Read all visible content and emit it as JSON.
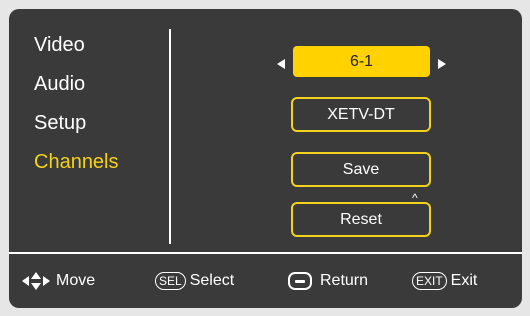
{
  "menu": {
    "items": [
      {
        "label": "Video"
      },
      {
        "label": "Audio"
      },
      {
        "label": "Setup"
      },
      {
        "label": "Channels"
      }
    ],
    "active_index": 3
  },
  "channel": {
    "number": "6-1",
    "name": "XETV-DT"
  },
  "buttons": {
    "save": "Save",
    "reset": "Reset"
  },
  "overlay_glyph": "^",
  "hints": {
    "move": {
      "label": "Move"
    },
    "select": {
      "key": "SEL",
      "label": "Select"
    },
    "return": {
      "label": "Return"
    },
    "exit": {
      "key": "EXIT",
      "label": "Exit"
    }
  },
  "colors": {
    "panel_bg": "#3a3a3a",
    "accent_yellow": "#f2d21b",
    "channel_fill": "#ffd200",
    "page_bg": "#e6e6e6"
  },
  "icons": [
    "left-arrow-icon",
    "right-arrow-icon",
    "four-way-arrow-icon",
    "minus-key-icon"
  ]
}
